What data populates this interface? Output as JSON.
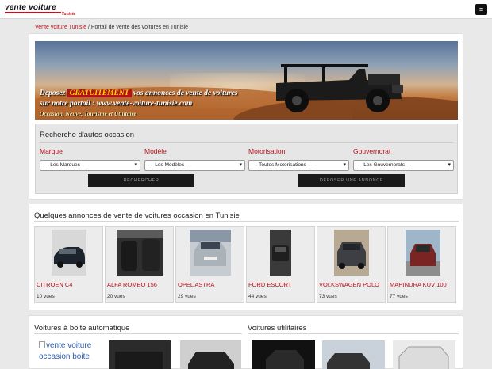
{
  "header": {
    "logo_main": "vente voiture",
    "logo_sub": "Tunisie",
    "menu_icon": "≡"
  },
  "breadcrumb": {
    "link": "Vente voiture Tunisie",
    "current": "Portail de vente des voitures en Tunisie"
  },
  "banner": {
    "line1_a": "Deposez",
    "line1_free": "GRATUITEMENT",
    "line1_b": "vos annonces de vente de voitures",
    "line2": "sur notre portail :  www.vente-voiture-tunisie.com",
    "line3": "Occasion, Neuve, Tourisme et Utilitaire"
  },
  "search": {
    "title": "Recherche d'autos occasion",
    "fields": [
      {
        "label": "Marque",
        "value": "--- Les Marques ---"
      },
      {
        "label": "Modèle",
        "value": "--- Les Modèles ---"
      },
      {
        "label": "Motorisation",
        "value": "--- Toutes Motorisations ---"
      },
      {
        "label": "Gouvernorat",
        "value": "--- Les Gouvernorats ---"
      }
    ],
    "search_button": "Rechercher",
    "deposit_button": "Déposer une annonce"
  },
  "annonces": {
    "title": "Quelques annonces de vente de voitures occasion en Tunisie",
    "items": [
      {
        "name": "CITROEN C4",
        "views": "10 vues",
        "color": "#1c232c"
      },
      {
        "name": "ALFA ROMEO 156",
        "views": "20 vues",
        "color": "#3a3a3a"
      },
      {
        "name": "OPEL ASTRA",
        "views": "29 vues",
        "color": "#b9bec4"
      },
      {
        "name": "FORD ESCORT",
        "views": "44 vues",
        "color": "#2a2a2a"
      },
      {
        "name": "VOLKSWAGEN POLO",
        "views": "73 vues",
        "color": "#3e3f44"
      },
      {
        "name": "MAHINDRA KUV 100",
        "views": "77 vues",
        "color": "#8a2a2a"
      }
    ]
  },
  "bottom": {
    "auto_title": "Voitures à boite automatique",
    "util_title": "Voitures utilitaires",
    "broken_alt": "vente voiture occasion boite"
  }
}
